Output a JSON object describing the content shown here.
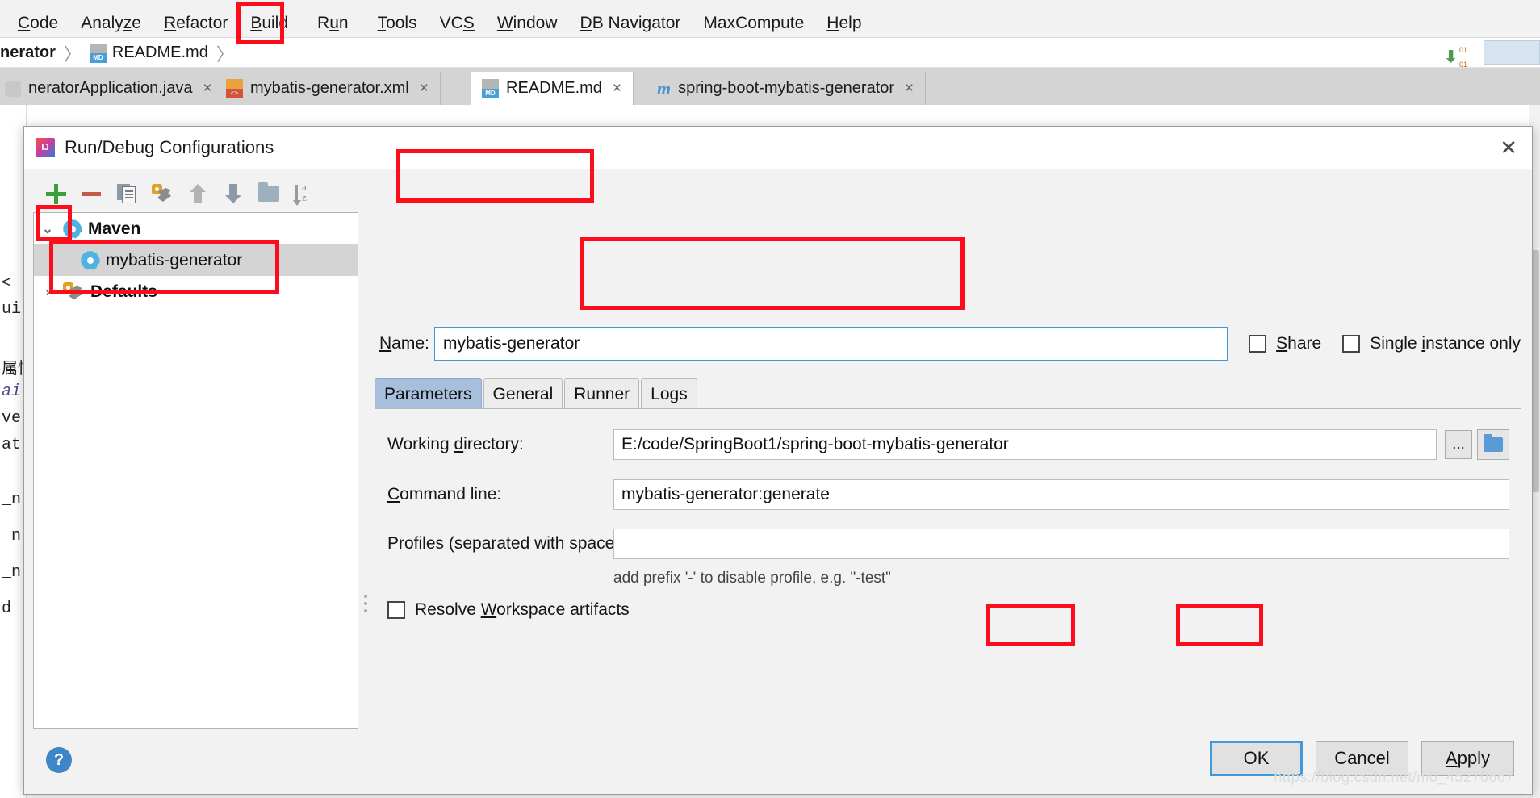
{
  "ide": {
    "menubar": {
      "items": [
        {
          "label": "Code",
          "mnemonic_index": 0
        },
        {
          "label": "Analyze",
          "mnemonic_index": 5
        },
        {
          "label": "Refactor",
          "mnemonic_index": 0
        },
        {
          "label": "Build",
          "mnemonic_index": 0
        },
        {
          "label": "Run",
          "mnemonic_index": 1
        },
        {
          "label": "Tools",
          "mnemonic_index": 0
        },
        {
          "label": "VCS",
          "mnemonic_index": 2
        },
        {
          "label": "Window",
          "mnemonic_index": 0
        },
        {
          "label": "DB Navigator",
          "mnemonic_index": 0
        },
        {
          "label": "MaxCompute",
          "mnemonic_index": 0
        },
        {
          "label": "Help",
          "mnemonic_index": 0
        }
      ]
    },
    "breadcrumb": {
      "project": "nerator",
      "file": "README.md",
      "file_icon": "markdown-file-icon",
      "separator": "〉"
    },
    "download_badge": {
      "arrow": "⬇",
      "line1": "01",
      "line2": "01"
    },
    "editor_tabs": [
      {
        "label": "neratorApplication.java",
        "icon": "java-file-icon",
        "active": false,
        "close": "×"
      },
      {
        "label": "mybatis-generator.xml",
        "icon": "xml-file-icon",
        "active": false,
        "close": "×"
      },
      {
        "label": "README.md",
        "icon": "markdown-file-icon",
        "active": true,
        "close": "×"
      },
      {
        "label": "spring-boot-mybatis-generator",
        "icon": "maven-module-icon",
        "active": false,
        "close": "×"
      }
    ],
    "editor_ghost_lines": [
      "<",
      "ui",
      "",
      "属性",
      "ai",
      "ve",
      "at",
      "",
      "_n",
      "_n",
      "_n",
      "d"
    ]
  },
  "dialog": {
    "title": "Run/Debug Configurations",
    "title_icon": "intellij-idea-icon",
    "close_icon": "✕",
    "toolbar": [
      {
        "name": "add-configuration-button",
        "icon": "plus-icon",
        "label": "+"
      },
      {
        "name": "remove-configuration-button",
        "icon": "minus-icon",
        "label": "−"
      },
      {
        "name": "copy-configuration-button",
        "icon": "copy-icon",
        "label": "Copy"
      },
      {
        "name": "edit-templates-button",
        "icon": "wrench-icon",
        "label": "Edit Templates"
      },
      {
        "name": "move-up-button",
        "icon": "arrow-up-icon",
        "label": "Move Up"
      },
      {
        "name": "move-down-button",
        "icon": "arrow-down-icon",
        "label": "Move Down"
      },
      {
        "name": "move-into-folder-button",
        "icon": "folder-icon",
        "label": "New Folder"
      },
      {
        "name": "sort-configurations-button",
        "icon": "sort-az-icon",
        "label": "Sort Configurations"
      }
    ],
    "tree": [
      {
        "label": "Maven",
        "icon": "maven-gear-icon",
        "expanded": true,
        "chevron": "⌄",
        "depth": 0,
        "bold": true,
        "selected": false
      },
      {
        "label": "mybatis-generator",
        "icon": "maven-gear-icon",
        "expanded": false,
        "chevron": "",
        "depth": 1,
        "bold": false,
        "selected": true
      },
      {
        "label": "Defaults",
        "icon": "wrench-defaults-icon",
        "expanded": false,
        "chevron": "›",
        "depth": 0,
        "bold": true,
        "selected": false
      }
    ],
    "name_field": {
      "label": "Name:",
      "mnemonic": "N",
      "value": "mybatis-generator",
      "placeholder": ""
    },
    "checkboxes_top": [
      {
        "label": "Share",
        "mnemonic": "S",
        "checked": false
      },
      {
        "label": "Single instance only",
        "mnemonic": "i",
        "checked": false
      }
    ],
    "tabs": [
      {
        "label": "Parameters",
        "active": true
      },
      {
        "label": "General",
        "active": false
      },
      {
        "label": "Runner",
        "active": false
      },
      {
        "label": "Logs",
        "active": false
      }
    ],
    "parameters": {
      "working_directory": {
        "label": "Working directory:",
        "value": "E:/code/SpringBoot1/spring-boot-mybatis-generator",
        "placeholder": "",
        "browse_label": "...",
        "folder_icon": "blue-folder-icon"
      },
      "command_line": {
        "label": "Command line:",
        "value": "mybatis-generator:generate",
        "placeholder": ""
      },
      "profiles": {
        "label": "Profiles (separated with space):",
        "value": "",
        "placeholder": "",
        "hint": "add prefix '-' to disable profile, e.g. \"-test\""
      },
      "resolve_workspace_artifacts": {
        "label": "Resolve Workspace artifacts",
        "checked": false
      }
    },
    "footer": {
      "help_label": "?",
      "ok_label": "OK",
      "cancel_label": "Cancel",
      "apply_label": "Apply"
    }
  },
  "watermark": "https://blog.csdn.net/m0_45270667",
  "colors": {
    "annotation_red": "#fc0d1b",
    "focus_blue": "#3f9ada",
    "selected_tab": "#a8bedd",
    "tree_selection": "#d4d4d4",
    "maven_gear": "#4eb3e0"
  }
}
